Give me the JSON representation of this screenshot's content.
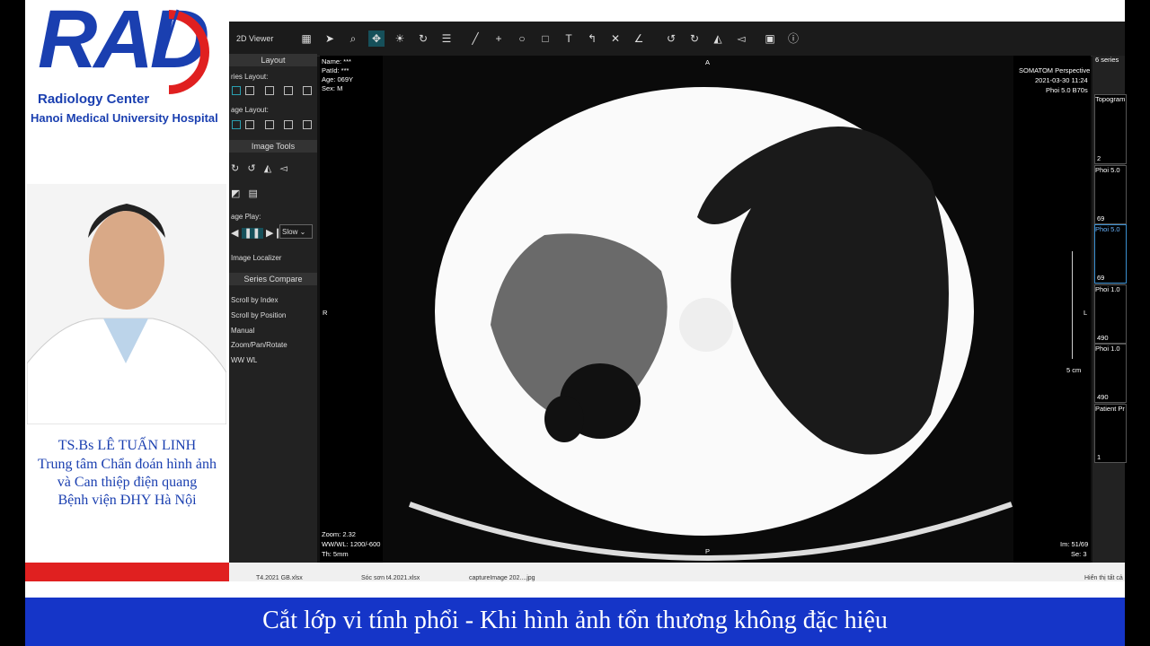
{
  "logo": {
    "main": "RAD",
    "line1": "Radiology Center",
    "line2": "Hanoi Medical University Hospital"
  },
  "presenter": {
    "name": "TS.Bs LÊ TUẤN LINH",
    "line1": "Trung tâm Chẩn đoán hình ảnh",
    "line2": "và Can thiệp điện quang",
    "line3": "Bệnh viện ĐHY Hà Nội"
  },
  "viewer": {
    "title": "2D Viewer",
    "toolbar_icons": [
      "grid-icon",
      "pointer-icon",
      "zoom-icon",
      "pan-icon",
      "window-level-icon",
      "rotate-icon",
      "menu-icon",
      "line-icon",
      "crosshair-icon",
      "ellipse-icon",
      "rectangle-icon",
      "text-icon",
      "arrow-icon",
      "delete-icon",
      "angle-icon",
      "rotate-left-icon",
      "rotate-right-icon",
      "flip-h-icon",
      "flip-v-icon",
      "save-icon",
      "info-icon"
    ],
    "sections": {
      "layout": "Layout",
      "series_layout": "ries Layout:",
      "image_layout": "age Layout:",
      "image_tools": "Image Tools",
      "image_play": "age Play:",
      "speed": "Slow",
      "localizer": "Image Localizer",
      "series_compare": "Series Compare",
      "scroll_index": "Scroll by Index",
      "scroll_position": "Scroll by Position",
      "manual": "Manual",
      "zoom_pan": "Zoom/Pan/Rotate",
      "wwwl": "WW WL"
    },
    "overlay": {
      "name": "Name: ***",
      "patid": "PatId: ***",
      "age": "Age: 069Y",
      "sex": "Sex: M",
      "device": "SOMATOM Perspective",
      "date": "2021-03-30  11:24",
      "kernel": "Phoi 5.0 B70s",
      "zoom": "Zoom: 2.32",
      "wwwl": "WW/WL: 1200/-600",
      "th": "Th: 5mm",
      "im": "Im: 51/69",
      "se": "Se: 3",
      "dir_a": "A",
      "dir_p": "P",
      "dir_r": "R",
      "dir_l": "L",
      "scale": "5 cm"
    },
    "thumbs": {
      "count": "6 series",
      "t1": "Topogram",
      "t2": "Phoi 5.0",
      "t3": "Phoi 5.0",
      "t4": "Phoi 1.0",
      "t5": "Phoi 1.0",
      "t6": "Patient Pr",
      "n1": "2",
      "n2": "69",
      "n3": "69",
      "n4": "490",
      "n5": "490",
      "n6": "1"
    }
  },
  "taskbar": {
    "f1": "T4.2021 GB.xlsx",
    "f2": "Sóc sơn t4.2021.xlsx",
    "f3": "captureImage 202....jpg",
    "show_all": "Hiển thị tất cả"
  },
  "caption": "Cắt lớp vi tính phổi - Khi hình ảnh tổn thương không đặc hiệu"
}
